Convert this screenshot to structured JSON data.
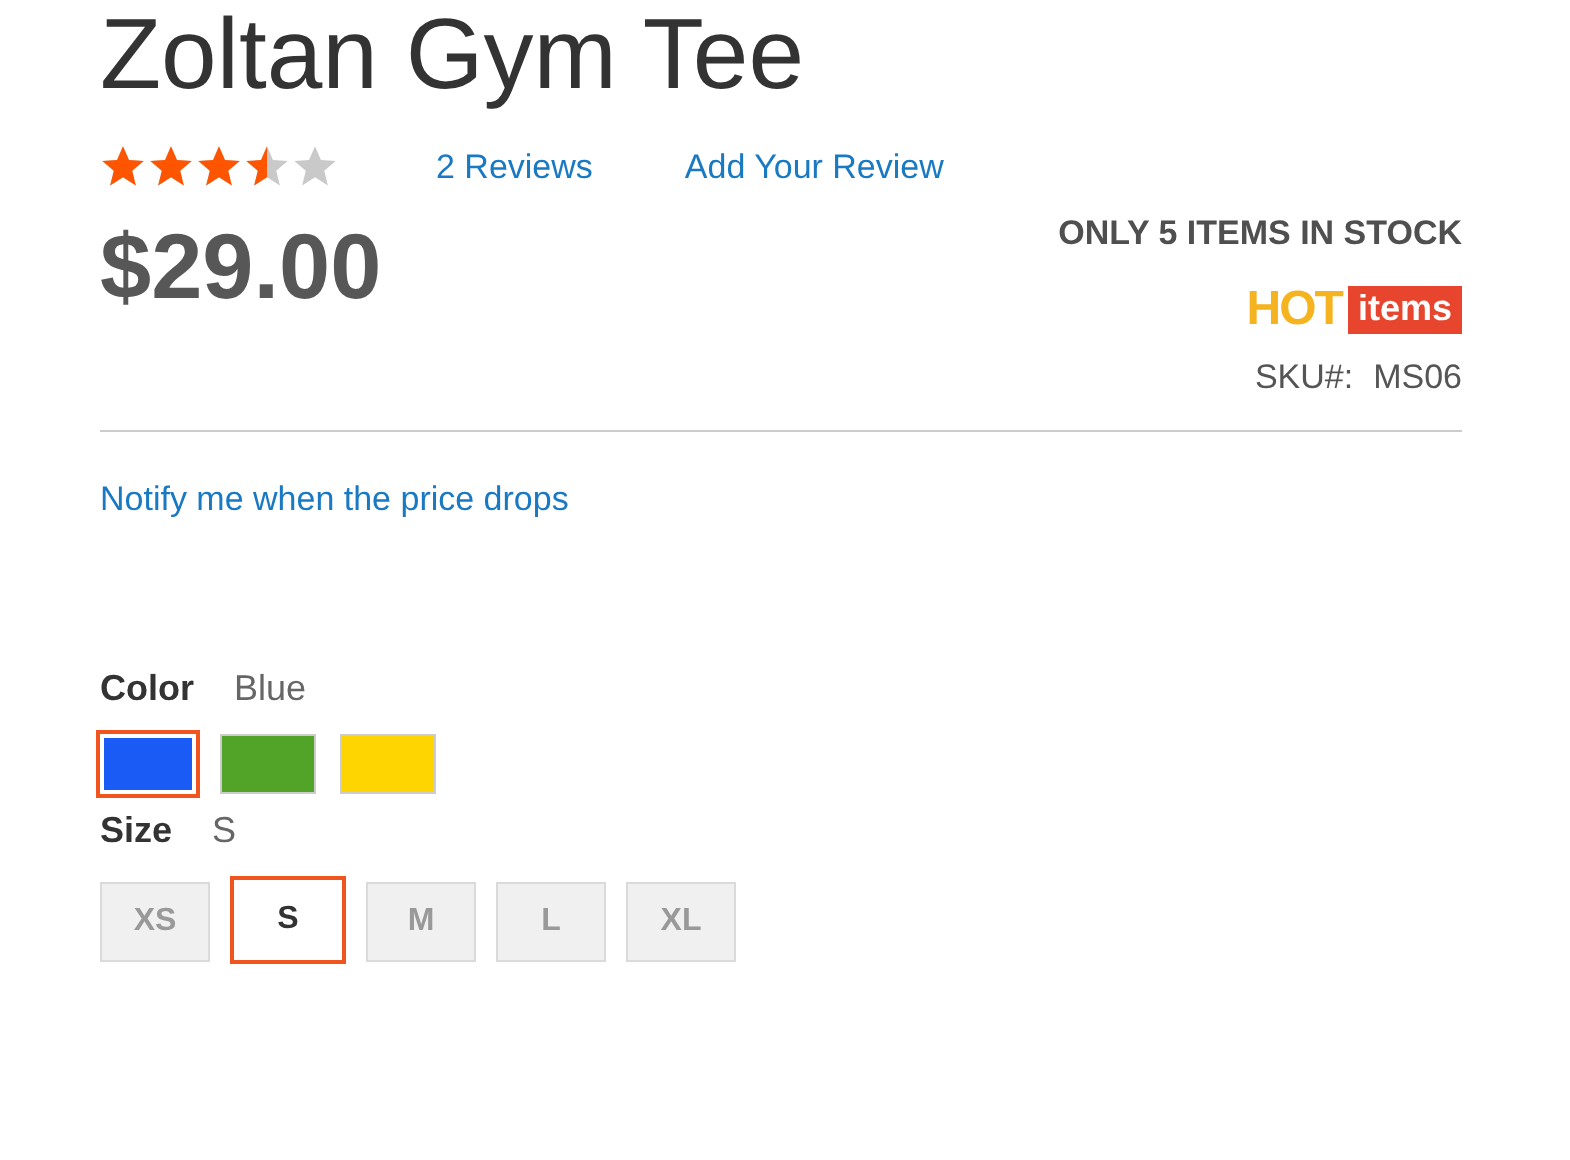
{
  "title": "Zoltan Gym Tee",
  "rating": {
    "stars": 3.5
  },
  "reviews_link": "2 Reviews",
  "add_review_link": "Add Your Review",
  "price": "$29.00",
  "stock": "ONLY 5 ITEMS IN STOCK",
  "badge": {
    "hot": "HOT",
    "items": "items"
  },
  "sku": {
    "label": "SKU#:",
    "value": "MS06"
  },
  "notify_link": "Notify me when the price drops",
  "color": {
    "label": "Color",
    "value": "Blue",
    "swatches": [
      {
        "color": "#1a5af5",
        "selected": true
      },
      {
        "color": "#52a428",
        "selected": false
      },
      {
        "color": "#ffd500",
        "selected": false
      }
    ]
  },
  "size": {
    "label": "Size",
    "value": "S",
    "options": [
      {
        "label": "XS",
        "selected": false
      },
      {
        "label": "S",
        "selected": true
      },
      {
        "label": "M",
        "selected": false
      },
      {
        "label": "L",
        "selected": false
      },
      {
        "label": "XL",
        "selected": false
      }
    ]
  }
}
